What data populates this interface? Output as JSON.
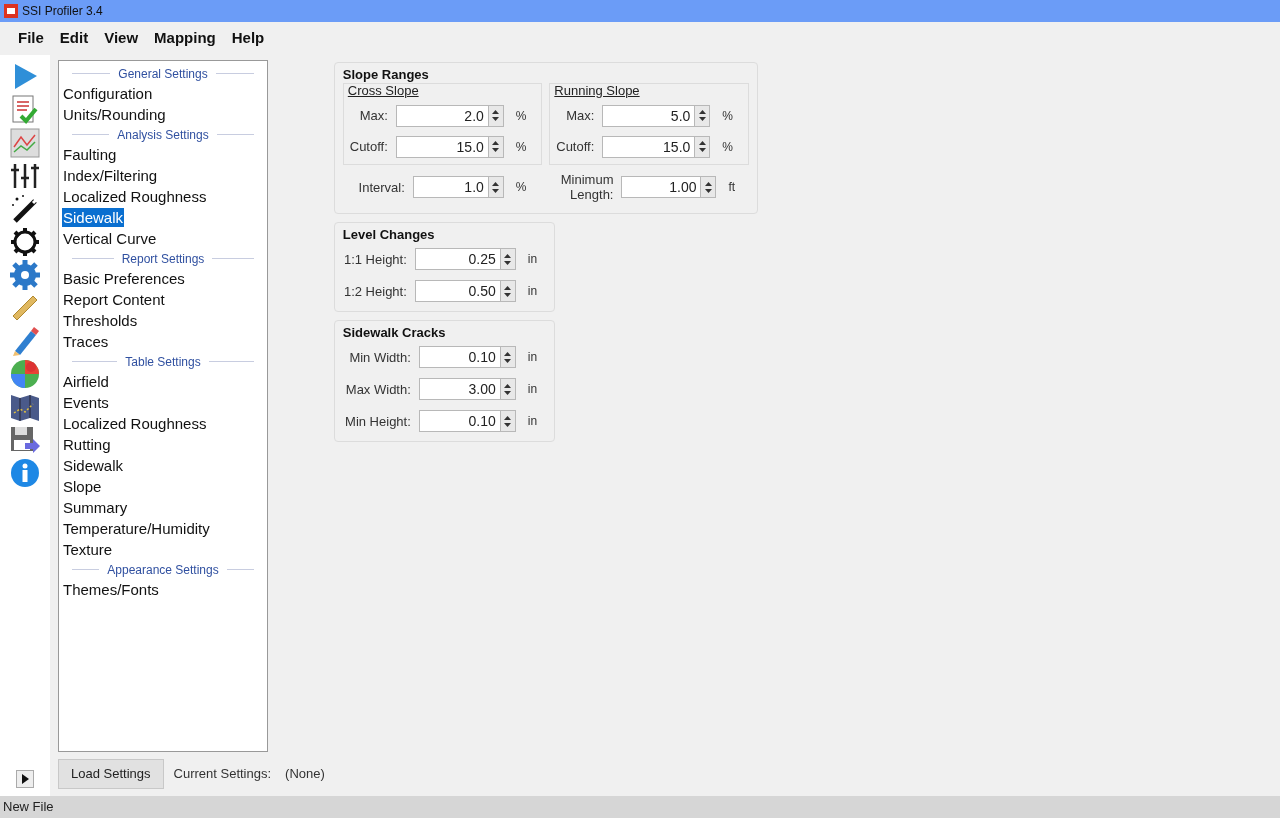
{
  "window": {
    "title": "SSI Profiler 3.4"
  },
  "menu": [
    "File",
    "Edit",
    "View",
    "Mapping",
    "Help"
  ],
  "settings_list": [
    {
      "header": "General Settings",
      "items": [
        {
          "label": "Configuration",
          "selected": false
        },
        {
          "label": "Units/Rounding",
          "selected": false
        }
      ]
    },
    {
      "header": "Analysis Settings",
      "items": [
        {
          "label": "Faulting",
          "selected": false
        },
        {
          "label": "Index/Filtering",
          "selected": false
        },
        {
          "label": "Localized Roughness",
          "selected": false
        },
        {
          "label": "Sidewalk",
          "selected": true
        },
        {
          "label": "Vertical Curve",
          "selected": false
        }
      ]
    },
    {
      "header": "Report Settings",
      "items": [
        {
          "label": "Basic Preferences",
          "selected": false
        },
        {
          "label": "Report Content",
          "selected": false
        },
        {
          "label": "Thresholds",
          "selected": false
        },
        {
          "label": "Traces",
          "selected": false
        }
      ]
    },
    {
      "header": "Table Settings",
      "items": [
        {
          "label": "Airfield",
          "selected": false
        },
        {
          "label": "Events",
          "selected": false
        },
        {
          "label": "Localized Roughness",
          "selected": false
        },
        {
          "label": "Rutting",
          "selected": false
        },
        {
          "label": "Sidewalk",
          "selected": false
        },
        {
          "label": "Slope",
          "selected": false
        },
        {
          "label": "Summary",
          "selected": false
        },
        {
          "label": "Temperature/Humidity",
          "selected": false
        },
        {
          "label": "Texture",
          "selected": false
        }
      ]
    },
    {
      "header": "Appearance Settings",
      "items": [
        {
          "label": "Themes/Fonts",
          "selected": false
        }
      ]
    }
  ],
  "slope_ranges": {
    "title": "Slope Ranges",
    "subgroups": [
      {
        "title": "Cross Slope",
        "fields": [
          {
            "label": "Max:",
            "value": "2.0",
            "unit": "%"
          },
          {
            "label": "Cutoff:",
            "value": "15.0",
            "unit": "%"
          }
        ]
      },
      {
        "title": "Running Slope",
        "fields": [
          {
            "label": "Max:",
            "value": "5.0",
            "unit": "%"
          },
          {
            "label": "Cutoff:",
            "value": "15.0",
            "unit": "%"
          }
        ]
      }
    ],
    "bottom_fields": [
      {
        "label": "Interval:",
        "value": "1.0",
        "unit": "%"
      },
      {
        "label": "Minimum Length:",
        "value": "1.00",
        "unit": "ft"
      }
    ]
  },
  "level_changes": {
    "title": "Level Changes",
    "fields": [
      {
        "label": "1:1 Height:",
        "value": "0.25",
        "unit": "in"
      },
      {
        "label": "1:2 Height:",
        "value": "0.50",
        "unit": "in"
      }
    ]
  },
  "sidewalk_cracks": {
    "title": "Sidewalk Cracks",
    "fields": [
      {
        "label": "Min Width:",
        "value": "0.10",
        "unit": "in"
      },
      {
        "label": "Max Width:",
        "value": "3.00",
        "unit": "in"
      },
      {
        "label": "Min Height:",
        "value": "0.10",
        "unit": "in"
      }
    ]
  },
  "bottom_bar": {
    "button": "Load Settings",
    "current_label": "Current Settings:",
    "current_value": "(None)"
  },
  "status_bar": "New File"
}
